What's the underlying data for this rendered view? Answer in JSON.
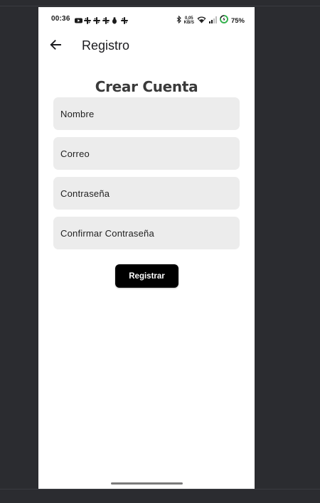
{
  "status_bar": {
    "time": "00:36",
    "network_speed_value": "0,05",
    "network_speed_unit": "KB/S",
    "battery": "75%",
    "notification_icons": [
      "youtube-icon",
      "slack-icon",
      "slack-icon",
      "slack-icon",
      "bug-icon",
      "slack-icon"
    ],
    "system_icons": [
      "bluetooth-icon",
      "wifi-icon",
      "signal-icon",
      "battery-icon"
    ]
  },
  "app_bar": {
    "title": "Registro",
    "back_icon": "arrow-left-icon"
  },
  "form": {
    "title": "Crear Cuenta",
    "fields": [
      {
        "placeholder": "Nombre"
      },
      {
        "placeholder": "Correo"
      },
      {
        "placeholder": "Contraseña"
      },
      {
        "placeholder": "Confirmar Contraseña"
      }
    ],
    "submit_label": "Registrar"
  },
  "colors": {
    "background": "#2b2c30",
    "screen": "#ffffff",
    "field_bg": "#ececec",
    "button_bg": "#000000",
    "button_text": "#ffffff",
    "battery_accent": "#2fb54a"
  }
}
